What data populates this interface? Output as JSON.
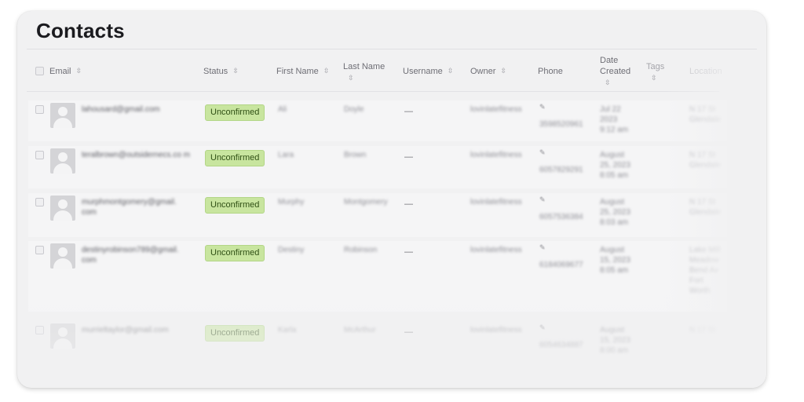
{
  "page": {
    "title": "Contacts"
  },
  "columns": {
    "email": "Email",
    "status": "Status",
    "first_name": "First Name",
    "last_name": "Last Name",
    "username": "Username",
    "owner": "Owner",
    "phone": "Phone",
    "date_created": "Date Created",
    "tags": "Tags",
    "location": "Location"
  },
  "icons": {
    "sort": "sort-updown-icon",
    "avatar": "user-avatar-icon",
    "edit": "pencil-icon"
  },
  "colors": {
    "status_badge_bg": "#c8e59f",
    "status_badge_text": "#2f4f14"
  },
  "rows": [
    {
      "email": "lahousard@gmail.com",
      "status": "Unconfirmed",
      "first_name": "Ali",
      "last_name": "Doyle",
      "username": "—",
      "owner": "lovinlatefitness",
      "phone": "3598520961",
      "date_created": "Jul 22 2023 9:12 am",
      "location": "N 17 St Glendale"
    },
    {
      "email": "teralbrown@outsidernecs.co m",
      "status": "Unconfirmed",
      "first_name": "Lara",
      "last_name": "Brown",
      "username": "—",
      "owner": "lovinlatefitness",
      "phone": "6057829291",
      "date_created": "August 25, 2023 8:05 am",
      "location": "N 17 St Glendale"
    },
    {
      "email": "murphmontgomery@gmail. com",
      "status": "Unconfirmed",
      "first_name": "Murphy",
      "last_name": "Montgomery",
      "username": "—",
      "owner": "lovinlatefitness",
      "phone": "6057536384",
      "date_created": "August 25, 2023 8:03 am",
      "location": "N 17 St Glendale"
    },
    {
      "email": "destinyrobinson789@gmail. com",
      "status": "Unconfirmed",
      "first_name": "Destiny",
      "last_name": "Robinson",
      "username": "—",
      "owner": "lovinlatefitness",
      "phone": "6184069677",
      "date_created": "August 15, 2023 8:05 am",
      "location": "Lake Mill Meadow Bend Av Fort Worth"
    },
    {
      "email": "murrieltaylor@gmail.com",
      "status": "Unconfirmed",
      "first_name": "Karla",
      "last_name": "McArthur",
      "username": "—",
      "owner": "lovinlatefitness",
      "phone": "6054634887",
      "date_created": "August 15, 2023 8:00 am",
      "location": "N 17 St"
    }
  ]
}
